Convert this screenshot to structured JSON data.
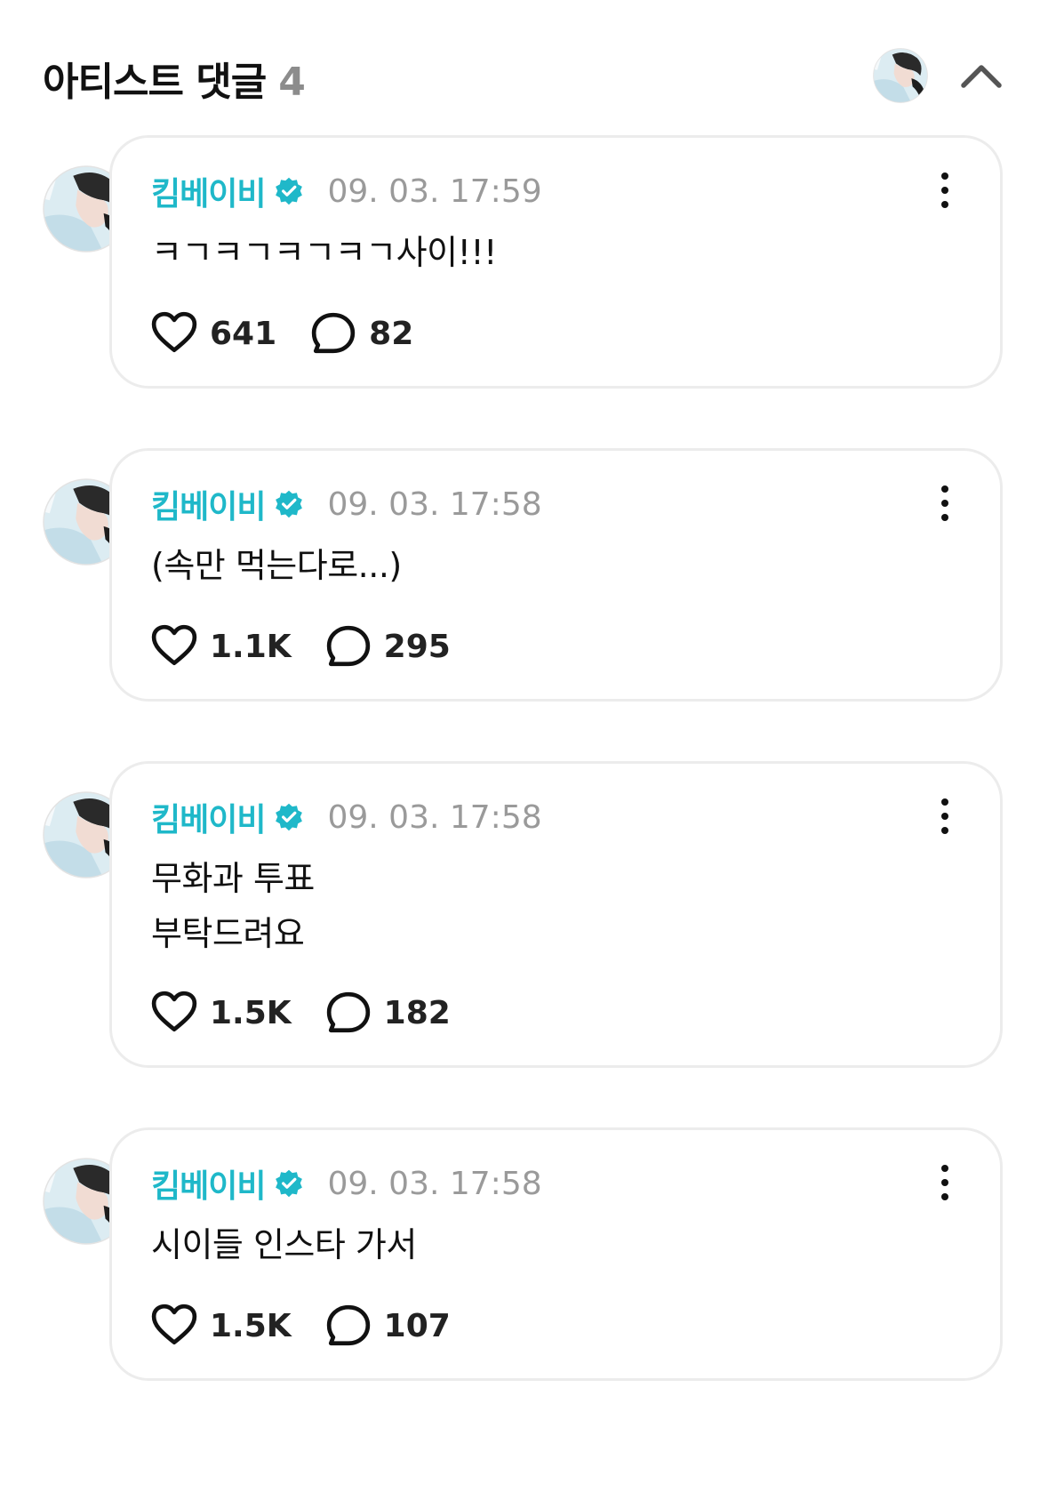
{
  "header": {
    "title": "아티스트 댓글",
    "count": "4",
    "collapse_icon": "chevron-up-icon"
  },
  "colors": {
    "author": "#1fb8c9",
    "verified_badge": "#1fb8c9",
    "timestamp": "#9a9a9a",
    "card_border": "#ececec"
  },
  "comments": [
    {
      "author": "킴베이비",
      "verified": true,
      "timestamp": "09. 03. 17:59",
      "text": "ㅋㄱㅋㄱㅋㄱㅋㄱ사이!!!",
      "likes": "641",
      "replies": "82"
    },
    {
      "author": "킴베이비",
      "verified": true,
      "timestamp": "09. 03. 17:58",
      "text": "(속만 먹는다로...)",
      "likes": "1.1K",
      "replies": "295"
    },
    {
      "author": "킴베이비",
      "verified": true,
      "timestamp": "09. 03. 17:58",
      "text": "무화과 투표\n부탁드려요",
      "likes": "1.5K",
      "replies": "182"
    },
    {
      "author": "킴베이비",
      "verified": true,
      "timestamp": "09. 03. 17:58",
      "text": "시이들 인스타 가서",
      "likes": "1.5K",
      "replies": "107"
    }
  ]
}
